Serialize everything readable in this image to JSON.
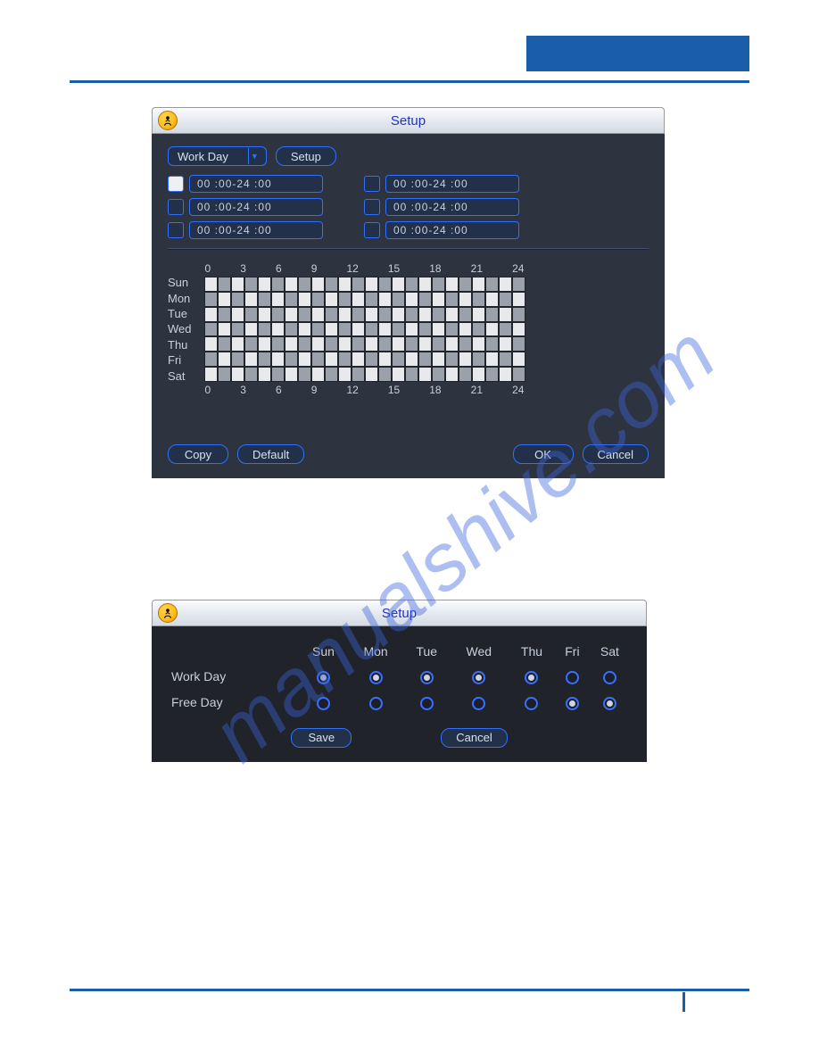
{
  "dialog1": {
    "title": "Setup",
    "day_type_selected": "Work Day",
    "setup_btn": "Setup",
    "time_rows_left": [
      {
        "start": "00 :00",
        "end": "-24 :00",
        "checked": "white"
      },
      {
        "start": "00 :00",
        "end": "-24 :00",
        "checked": "off"
      },
      {
        "start": "00 :00",
        "end": "-24 :00",
        "checked": "off"
      }
    ],
    "time_rows_right": [
      {
        "start": "00 :00",
        "end": "-24 :00",
        "checked": "off"
      },
      {
        "start": "00 :00",
        "end": "-24 :00",
        "checked": "off"
      },
      {
        "start": "00 :00",
        "end": "-24 :00",
        "checked": "off"
      }
    ],
    "hours": [
      "0",
      "3",
      "6",
      "9",
      "12",
      "15",
      "18",
      "21",
      "24"
    ],
    "days": [
      "Sun",
      "Mon",
      "Tue",
      "Wed",
      "Thu",
      "Fri",
      "Sat"
    ],
    "buttons": {
      "copy": "Copy",
      "default": "Default",
      "ok": "OK",
      "cancel": "Cancel"
    }
  },
  "dialog2": {
    "title": "Setup",
    "days": [
      "Sun",
      "Mon",
      "Tue",
      "Wed",
      "Thu",
      "Fri",
      "Sat"
    ],
    "rows": [
      {
        "label": "Work Day",
        "values": [
          true,
          true,
          true,
          true,
          true,
          false,
          false
        ]
      },
      {
        "label": "Free Day",
        "values": [
          false,
          false,
          false,
          false,
          false,
          true,
          true
        ]
      }
    ],
    "buttons": {
      "save": "Save",
      "cancel": "Cancel"
    }
  }
}
